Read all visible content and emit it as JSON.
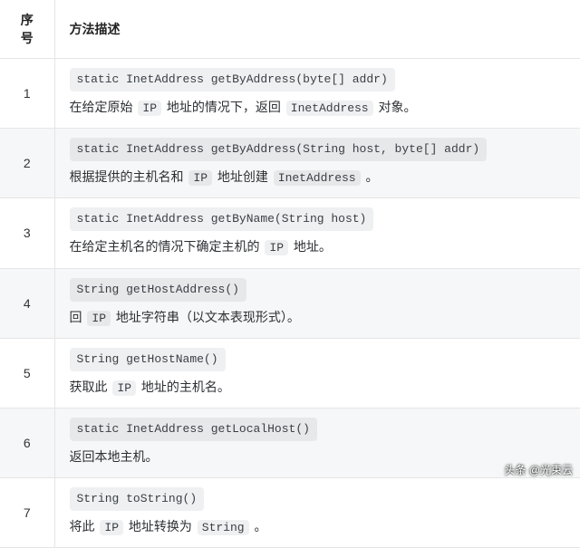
{
  "headers": {
    "index": "序号",
    "desc": "方法描述"
  },
  "rows": [
    {
      "num": "1",
      "code": "static InetAddress getByAddress(byte[] addr)",
      "desc": [
        {
          "t": "text",
          "v": "在给定原始 "
        },
        {
          "t": "kw",
          "v": "IP"
        },
        {
          "t": "text",
          "v": " 地址的情况下，返回 "
        },
        {
          "t": "kw",
          "v": "InetAddress"
        },
        {
          "t": "text",
          "v": " 对象。"
        }
      ]
    },
    {
      "num": "2",
      "code": "static InetAddress getByAddress(String host, byte[] addr)",
      "desc": [
        {
          "t": "text",
          "v": "根据提供的主机名和 "
        },
        {
          "t": "kw",
          "v": "IP"
        },
        {
          "t": "text",
          "v": " 地址创建 "
        },
        {
          "t": "kw",
          "v": "InetAddress"
        },
        {
          "t": "text",
          "v": " 。"
        }
      ]
    },
    {
      "num": "3",
      "code": "static InetAddress getByName(String host)",
      "desc": [
        {
          "t": "text",
          "v": "在给定主机名的情况下确定主机的 "
        },
        {
          "t": "kw",
          "v": "IP"
        },
        {
          "t": "text",
          "v": " 地址。"
        }
      ]
    },
    {
      "num": "4",
      "code": "String getHostAddress()",
      "desc": [
        {
          "t": "text",
          "v": "回 "
        },
        {
          "t": "kw",
          "v": "IP"
        },
        {
          "t": "text",
          "v": " 地址字符串（以文本表现形式）。"
        }
      ]
    },
    {
      "num": "5",
      "code": "String getHostName()",
      "desc": [
        {
          "t": "text",
          "v": "获取此 "
        },
        {
          "t": "kw",
          "v": "IP"
        },
        {
          "t": "text",
          "v": " 地址的主机名。"
        }
      ]
    },
    {
      "num": "6",
      "code": "static InetAddress getLocalHost()",
      "desc": [
        {
          "t": "text",
          "v": "返回本地主机。"
        }
      ]
    },
    {
      "num": "7",
      "code": "String toString()",
      "desc": [
        {
          "t": "text",
          "v": "将此 "
        },
        {
          "t": "kw",
          "v": "IP"
        },
        {
          "t": "text",
          "v": " 地址转换为 "
        },
        {
          "t": "kw",
          "v": "String"
        },
        {
          "t": "text",
          "v": " 。"
        }
      ]
    }
  ],
  "watermark": "头条 @光束云"
}
